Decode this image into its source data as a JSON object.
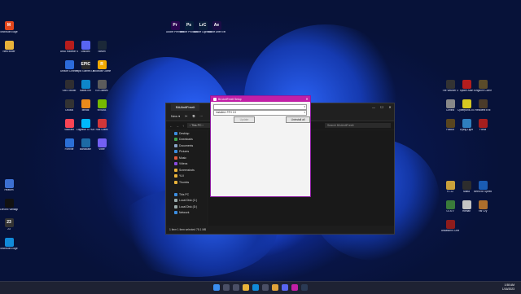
{
  "desktop": {
    "icons": [
      {
        "label": "Microsoft Edge",
        "glyph": "M",
        "color": "#e2461d"
      },
      {
        "label": "New folder",
        "glyph": "",
        "color": "#e8b23a"
      },
      {
        "label": "AMD Radeon Software",
        "glyph": "",
        "color": "#b71c1c"
      },
      {
        "label": "Discord",
        "glyph": "",
        "color": "#5865f2"
      },
      {
        "label": "Steam",
        "glyph": "",
        "color": "#1b2838"
      },
      {
        "label": "Ubisoft Connect",
        "glyph": "",
        "color": "#2c6bd9"
      },
      {
        "label": "Epic Games Launcher",
        "glyph": "EPIC",
        "color": "#2a2a2a"
      },
      {
        "label": "Rockstar Games Launcher",
        "glyph": "R",
        "color": "#f2a900"
      },
      {
        "label": "OBS Studio",
        "glyph": "",
        "color": "#302e31"
      },
      {
        "label": "Battle.net",
        "glyph": "",
        "color": "#0e86ca"
      },
      {
        "label": "EA Games",
        "glyph": "",
        "color": "#5c5c5c"
      },
      {
        "label": "Oculus",
        "glyph": "",
        "color": "#333"
      },
      {
        "label": "Medal",
        "glyph": "",
        "color": "#ea8a1b"
      },
      {
        "label": "NVIDIA",
        "glyph": "",
        "color": "#76b900"
      },
      {
        "label": "Valorant",
        "glyph": "",
        "color": "#fa4454"
      },
      {
        "label": "Logitech G HUB",
        "glyph": "",
        "color": "#00b8fc"
      },
      {
        "label": "Riot Client",
        "glyph": "",
        "color": "#d13639"
      },
      {
        "label": "Fortnite",
        "glyph": "",
        "color": "#2b6fd6"
      },
      {
        "label": "Bandicam",
        "glyph": "",
        "color": "#1d6aa5"
      },
      {
        "label": "Viber",
        "glyph": "",
        "color": "#7360f2"
      }
    ],
    "adobe": [
      {
        "label": "Adobe Premiere Pro",
        "glyph": "Pr",
        "color": "#2a0650"
      },
      {
        "label": "Adobe Photoshop",
        "glyph": "Ps",
        "color": "#061e3c"
      },
      {
        "label": "Adobe Lightroom",
        "glyph": "LrC",
        "color": "#0a1e3b"
      },
      {
        "label": "Adobe After Effects",
        "glyph": "Ae",
        "color": "#1b0d46"
      }
    ],
    "left_bottom": [
      {
        "label": "Heaven",
        "glyph": "",
        "color": "#3c6fd0"
      },
      {
        "label": "Lenovo Vantage",
        "glyph": "",
        "color": "#111"
      },
      {
        "label": "23",
        "glyph": "23",
        "color": "#333"
      },
      {
        "label": "Microsoft Edge",
        "glyph": "",
        "color": "#118ad8"
      }
    ],
    "right": [
      {
        "label": "The Witcher 3",
        "glyph": "",
        "color": "#333"
      },
      {
        "label": "Spider-Man",
        "glyph": "",
        "color": "#b41d1d"
      },
      {
        "label": "Kingdom Come",
        "glyph": "",
        "color": "#5a4b2a"
      },
      {
        "label": "Control",
        "glyph": "",
        "color": "#888"
      },
      {
        "label": "Cyberpunk 2077",
        "glyph": "",
        "color": "#d6c821"
      },
      {
        "label": "Resident Evil",
        "glyph": "",
        "color": "#4a3b2a"
      },
      {
        "label": "Fallout",
        "glyph": "",
        "color": "#59451f"
      },
      {
        "label": "Dying Light",
        "glyph": "",
        "color": "#2f7fbf"
      },
      {
        "label": "Forza",
        "glyph": "",
        "color": "#a61e1e"
      },
      {
        "label": "F1 22",
        "glyph": "",
        "color": "#c9a03b"
      },
      {
        "label": "Mafia",
        "glyph": "",
        "color": "#2d2d2d"
      },
      {
        "label": "Need for Speed",
        "glyph": "",
        "color": "#1a5cb3"
      },
      {
        "label": "GTA V",
        "glyph": "",
        "color": "#3a7b3a"
      },
      {
        "label": "Hitman",
        "glyph": "",
        "color": "#c4c4c4"
      },
      {
        "label": "Far Cry",
        "glyph": "",
        "color": "#ad6e2c"
      },
      {
        "label": "Assassin's Creed",
        "glyph": "",
        "color": "#8e1c1c"
      }
    ]
  },
  "explorer": {
    "tab_title": "BAAinitFreeit",
    "toolbar": [
      "New ▾",
      "✂",
      "⧉",
      "⋯"
    ],
    "address": "› This PC › ",
    "search_placeholder": "Search BAAinitFreeit",
    "nav": [
      {
        "label": "Desktop",
        "color": "#3b8de0"
      },
      {
        "label": "Downloads",
        "color": "#3fa34d"
      },
      {
        "label": "Documents",
        "color": "#8ba4c8"
      },
      {
        "label": "Pictures",
        "color": "#3b8de0"
      },
      {
        "label": "Music",
        "color": "#e05a3b"
      },
      {
        "label": "Videos",
        "color": "#8a4be0"
      },
      {
        "label": "Screenshots",
        "color": "#e8b23a"
      },
      {
        "label": "YUI",
        "color": "#e8b23a"
      },
      {
        "label": "Thumbs",
        "color": "#e8b23a"
      },
      {
        "label": "",
        "color": "transparent"
      },
      {
        "label": "This PC",
        "color": "#3b8de0"
      },
      {
        "label": "Local Disk (C:)",
        "color": "#9aa"
      },
      {
        "label": "Local Disk (D:)",
        "color": "#9aa"
      },
      {
        "label": "Network",
        "color": "#3b8de0"
      }
    ],
    "file_name": "decrypter",
    "status": "1 item    1 item selected 78.1 MB"
  },
  "setup": {
    "title": "BA AntiFreeit Setup",
    "dropdown1": "",
    "dropdown2": "Installed: FFH 2.0",
    "btn_update": "Update",
    "btn_uninstall": "Uninstall all"
  },
  "tray": {
    "time": "1:58 AM",
    "date": "1/16/2023"
  }
}
